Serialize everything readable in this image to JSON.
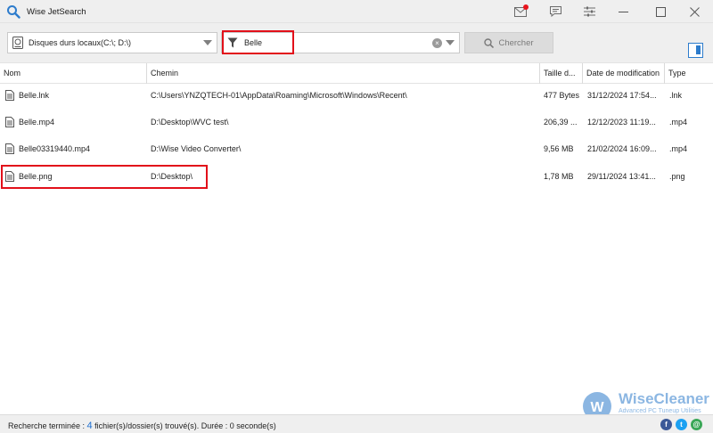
{
  "window": {
    "title": "Wise JetSearch"
  },
  "toolbar": {
    "drive_label": "Disques durs locaux(C:\\; D:\\)",
    "search_value": "Belle",
    "search_button_label": "Chercher"
  },
  "table": {
    "columns": [
      "Nom",
      "Chemin",
      "Taille d...",
      "Date de modification",
      "Type"
    ],
    "rows": [
      {
        "name": "Belle.lnk",
        "path": "C:\\Users\\YNZQTECH-01\\AppData\\Roaming\\Microsoft\\Windows\\Recent\\",
        "size": "477 Bytes",
        "date": "31/12/2024 17:54...",
        "type": ".lnk"
      },
      {
        "name": "Belle.mp4",
        "path": "D:\\Desktop\\WVC test\\",
        "size": "206,39 ...",
        "date": "12/12/2023 11:19...",
        "type": ".mp4"
      },
      {
        "name": "Belle03319440.mp4",
        "path": "D:\\Wise Video Converter\\",
        "size": "9,56 MB",
        "date": "21/02/2024 16:09...",
        "type": ".mp4"
      },
      {
        "name": "Belle.png",
        "path": "D:\\Desktop\\",
        "size": "1,78 MB",
        "date": "29/11/2024 13:41...",
        "type": ".png"
      }
    ]
  },
  "status": {
    "prefix": "Recherche terminée : ",
    "count": "4",
    "suffix": " fichier(s)/dossier(s) trouvé(s). Durée : 0 seconde(s)"
  },
  "watermark": {
    "name": "WiseCleaner",
    "tagline": "Advanced PC Tuneup Utilities"
  },
  "colors": {
    "accent": "#2d7ccc",
    "highlight": "#e2101a",
    "notification": "#e8141c"
  }
}
